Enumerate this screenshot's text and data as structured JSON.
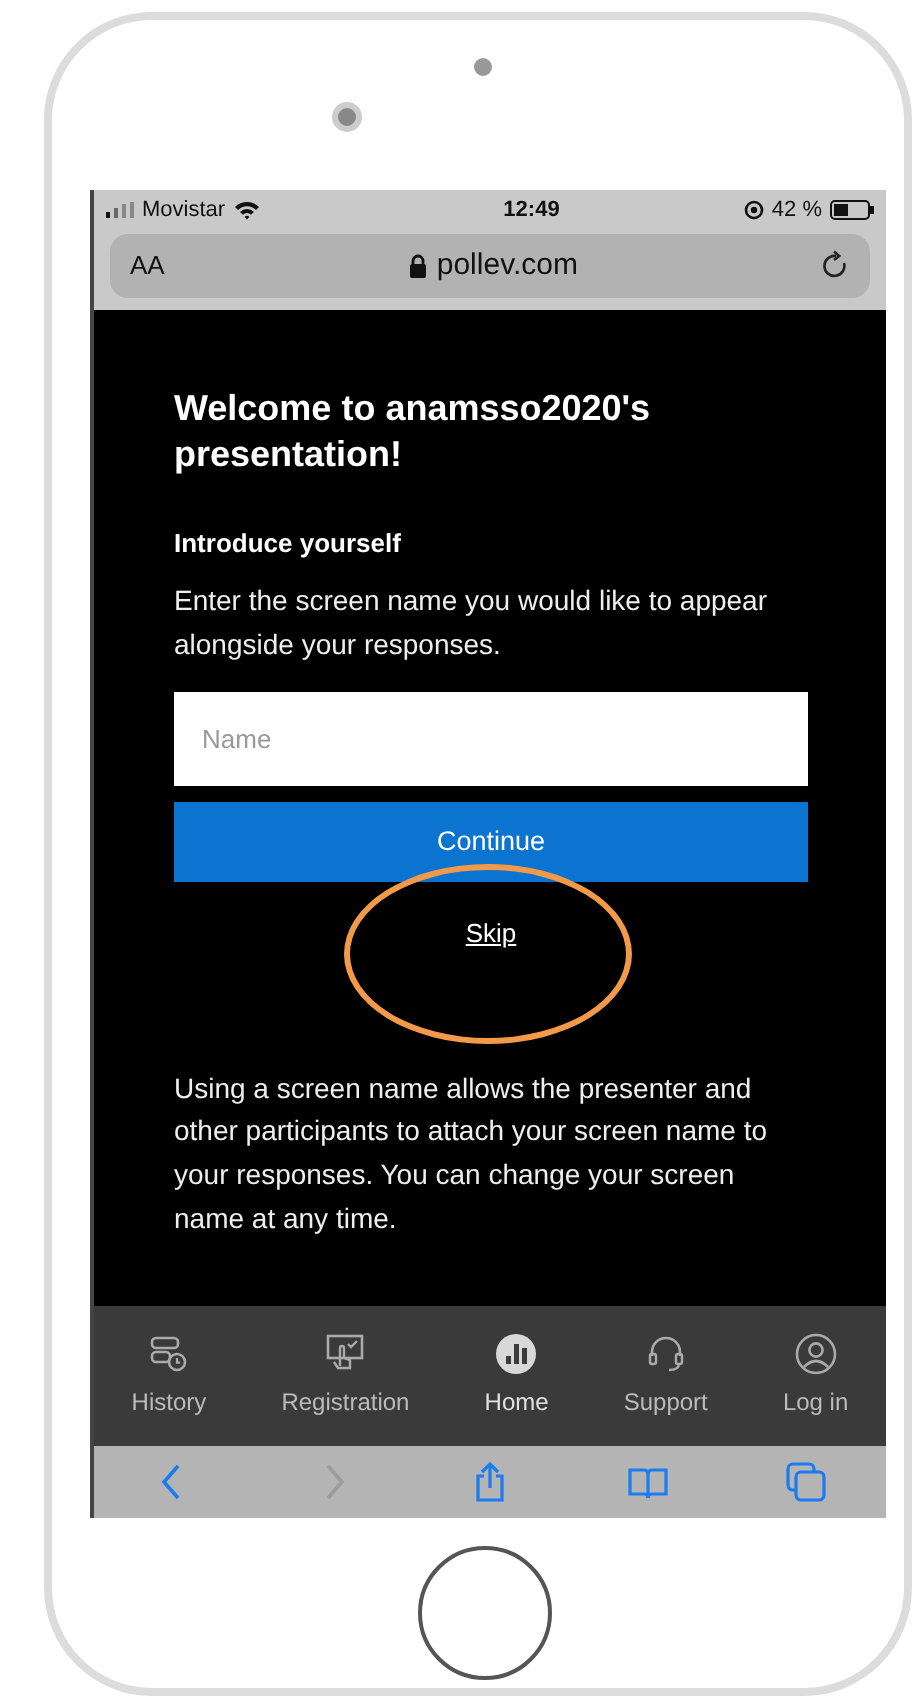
{
  "status_bar": {
    "carrier": "Movistar",
    "time": "12:49",
    "battery": "42 %"
  },
  "address_bar": {
    "text_size": "AA",
    "url": "pollev.com"
  },
  "page": {
    "title": "Welcome to anamsso2020's presentation!",
    "section": "Introduce yourself",
    "instructions": "Enter the screen name you would like to appear alongside your responses.",
    "name_field": {
      "placeholder": "Name"
    },
    "continue_button": "Continue",
    "skip_link": "Skip",
    "note": "Using a screen name allows the presenter and other participants to attach your screen name to your responses. You can change your screen name at any time."
  },
  "tab_bar": [
    {
      "label": "History",
      "kind": "history",
      "selected": false
    },
    {
      "label": "Registration",
      "kind": "registration",
      "selected": false
    },
    {
      "label": "Home",
      "kind": "home",
      "selected": true
    },
    {
      "label": "Support",
      "kind": "support",
      "selected": false
    },
    {
      "label": "Log in",
      "kind": "login",
      "selected": false
    }
  ],
  "toolbar": [
    {
      "kind": "back",
      "disabled": false
    },
    {
      "kind": "forward",
      "disabled": true
    },
    {
      "kind": "share",
      "disabled": false
    },
    {
      "kind": "bookmarks",
      "disabled": false
    },
    {
      "kind": "tabs",
      "disabled": false
    }
  ]
}
